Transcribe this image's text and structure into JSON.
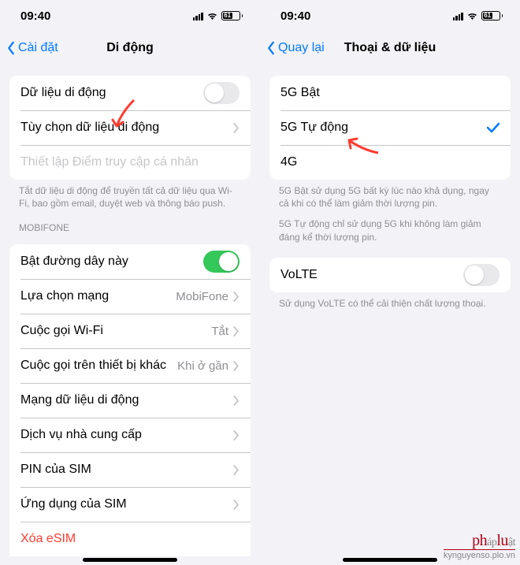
{
  "status": {
    "time": "09:40",
    "battery": "61"
  },
  "left": {
    "back": "Cài đặt",
    "title": "Di động",
    "group1": {
      "cellular_data": "Dữ liệu di động",
      "data_options": "Tùy chọn dữ liệu di động",
      "hotspot": "Thiết lập Điểm truy cập cá nhân"
    },
    "footer1": "Tắt dữ liệu di động để truyền tất cả dữ liệu qua Wi-Fi, bao gồm email, duyệt web và thông báo push.",
    "section_carrier": "MOBIFONE",
    "group2": {
      "turn_on_line": "Bật đường dây này",
      "network_selection": {
        "label": "Lựa chọn mạng",
        "value": "MobiFone"
      },
      "wifi_calling": {
        "label": "Cuộc gọi Wi-Fi",
        "value": "Tắt"
      },
      "calls_other": {
        "label": "Cuộc gọi trên thiết bị khác",
        "value": "Khi ở gần"
      },
      "cellular_network": "Mạng dữ liệu di động",
      "carrier_services": "Dịch vụ nhà cung cấp",
      "sim_pin": "PIN của SIM",
      "sim_apps": "Ứng dụng của SIM",
      "delete_esim": "Xóa eSIM"
    }
  },
  "right": {
    "back": "Quay lại",
    "title": "Thoại & dữ liệu",
    "options": {
      "g5_on": "5G Bật",
      "g5_auto": "5G Tự động",
      "g4": "4G"
    },
    "footer_a": "5G Bật sử dụng 5G bất kỳ lúc nào khả dụng, ngay cả khi có thể làm giảm thời lượng pin.",
    "footer_b": "5G Tự động chỉ sử dụng 5G khi không làm giảm đáng kể thời lượng pin.",
    "volte": "VoLTE",
    "footer_volte": "Sử dụng VoLTE có thể cải thiện chất lượng thoại."
  },
  "watermark": {
    "sub": "kynguyenso.plo.vn"
  }
}
